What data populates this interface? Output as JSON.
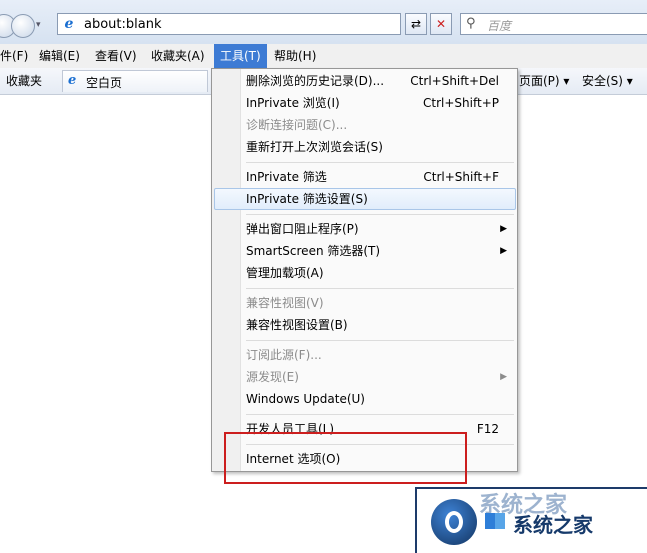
{
  "address_bar": {
    "url": "about:blank",
    "search_placeholder": "百度"
  },
  "menubar": {
    "items": [
      "件(F)",
      "编辑(E)",
      "查看(V)",
      "收藏夹(A)",
      "工具(T)",
      "帮助(H)"
    ],
    "active_index": 4
  },
  "favorites_bar": {
    "favorites_label": "收藏夹",
    "tab_title": "空白页",
    "page_menu": "页面(P) ▾",
    "safety_menu": "安全(S) ▾"
  },
  "tools_menu": {
    "items": [
      {
        "label": "删除浏览的历史记录(D)...",
        "shortcut": "Ctrl+Shift+Del"
      },
      {
        "label": "InPrivate 浏览(I)",
        "shortcut": "Ctrl+Shift+P"
      },
      {
        "label": "诊断连接问题(C)...",
        "disabled": true
      },
      {
        "label": "重新打开上次浏览会话(S)"
      },
      {
        "label": "InPrivate 筛选",
        "shortcut": "Ctrl+Shift+F"
      },
      {
        "label": "InPrivate 筛选设置(S)",
        "hovered": true
      },
      {
        "label": "弹出窗口阻止程序(P)",
        "submenu": true
      },
      {
        "label": "SmartScreen 筛选器(T)",
        "submenu": true
      },
      {
        "label": "管理加载项(A)"
      },
      {
        "label": "兼容性视图(V)",
        "disabled": true
      },
      {
        "label": "兼容性视图设置(B)"
      },
      {
        "label": "订阅此源(F)...",
        "disabled": true
      },
      {
        "label": "源发现(E)",
        "disabled": true,
        "submenu": true
      },
      {
        "label": "Windows Update(U)"
      },
      {
        "label": "开发人员工具(L)",
        "shortcut": "F12"
      },
      {
        "label": "Internet 选项(O)",
        "annotated": true
      }
    ]
  },
  "watermark": {
    "text": "系统之家",
    "faded_text": "系统之家"
  },
  "colors": {
    "menu_active": "#3d7bd4",
    "annotation_box": "#cc1e1e"
  }
}
